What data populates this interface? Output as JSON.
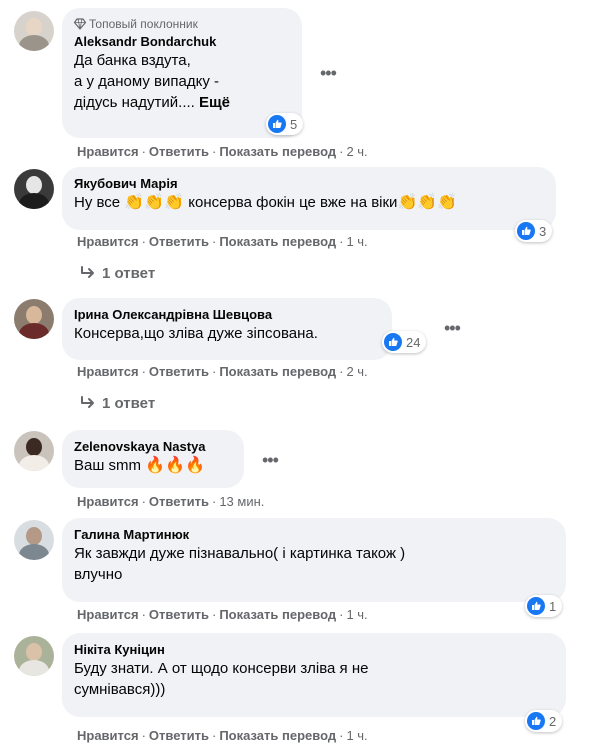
{
  "comments": [
    {
      "badge": "Топовый поклонник",
      "author": "Aleksandr Bondarchuk",
      "lines": [
        "Да банка вздута,",
        "а у даному випадку -",
        "дідусь надутий...."
      ],
      "more": "Ещё",
      "reactions": "5",
      "like": "Нравится",
      "reply": "Ответить",
      "translate": "Показать перевод",
      "time": "2 ч."
    },
    {
      "author": "Якубович Марія",
      "text_a": "Ну все ",
      "emoji_a": "👏👏👏",
      "text_b": " консерва фокін це вже на віки",
      "emoji_b": "👏👏👏",
      "reactions": "3",
      "like": "Нравится",
      "reply": "Ответить",
      "translate": "Показать перевод",
      "time": "1 ч.",
      "replies": "1 ответ"
    },
    {
      "author": "Ірина Олександрівна Шевцова",
      "text": "Консерва,що зліва дуже зіпсована.",
      "reactions": "24",
      "like": "Нравится",
      "reply": "Ответить",
      "translate": "Показать перевод",
      "time": "2 ч.",
      "replies": "1 ответ"
    },
    {
      "author": "Zelenovskaya Nastya",
      "text": "Ваш smm ",
      "emoji": "🔥🔥🔥",
      "like": "Нравится",
      "reply": "Ответить",
      "time": "13 мин."
    },
    {
      "author": "Галина Мартинюк",
      "lines": [
        "Як завжди дуже пізнавально( і картинка також )",
        "влучно"
      ],
      "reactions": "1",
      "like": "Нравится",
      "reply": "Ответить",
      "translate": "Показать перевод",
      "time": "1 ч."
    },
    {
      "author": "Нікіта Куніцин",
      "lines": [
        "Буду знати. А от щодо консерви зліва я не",
        "сумнівався)))"
      ],
      "reactions": "2",
      "like": "Нравится",
      "reply": "Ответить",
      "translate": "Показать перевод",
      "time": "1 ч."
    }
  ],
  "icons": {
    "more_options": "more-horizontal-icon",
    "like_reaction": "thumbs-up-icon",
    "reply_arrow": "reply-arrow-icon",
    "top_fan": "diamond-badge-icon"
  },
  "colors": {
    "bubble": "#f0f2f5",
    "like": "#1877f2",
    "secondary_text": "#65676b",
    "primary_text": "#050505"
  }
}
